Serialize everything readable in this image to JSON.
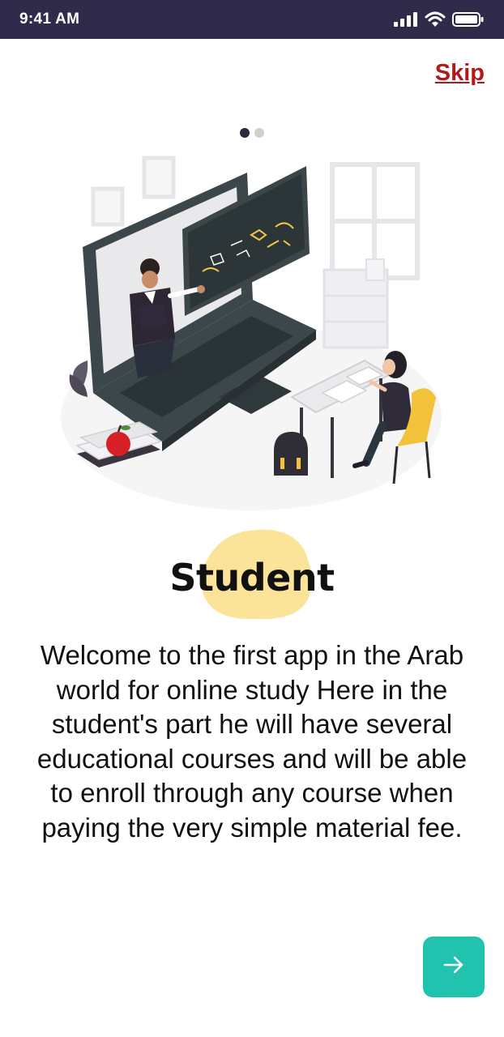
{
  "status_bar": {
    "time": "9:41 AM"
  },
  "onboarding": {
    "skip_label": "Skip",
    "page_index": 1,
    "page_count": 2,
    "title": "Student",
    "description": "Welcome to the first app in the Arab world for online study Here in the student's part he will have several educational courses and will be able to enroll through any course when paying the very simple material fee.",
    "next_icon": "arrow-right-icon"
  },
  "colors": {
    "status_bar": "#302a4b",
    "skip": "#b11a1a",
    "accent": "#21c3ae",
    "title_highlight": "#fbe49a",
    "dot_active": "#2d2a40",
    "dot_inactive": "#d0d0d0"
  }
}
